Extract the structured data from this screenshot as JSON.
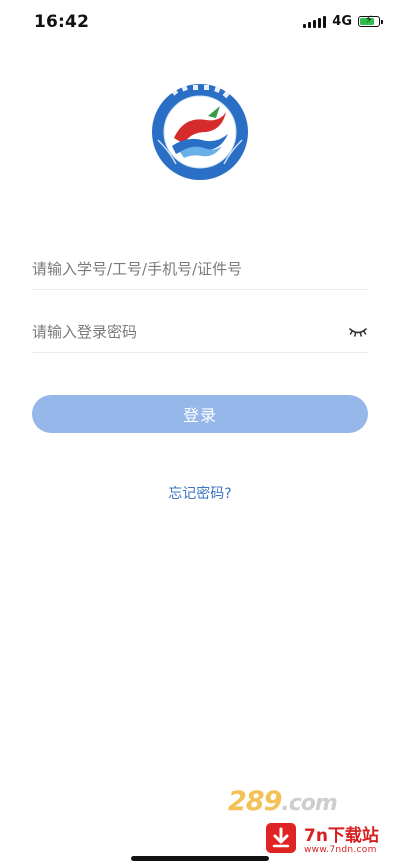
{
  "status_bar": {
    "time": "16:42",
    "network": "4G",
    "battery_level": 0.8,
    "charging": true
  },
  "logo": {
    "name": "school-logo"
  },
  "login_form": {
    "account_placeholder": "请输入学号/工号/手机号/证件号",
    "account_value": "",
    "password_placeholder": "请输入登录密码",
    "password_value": "",
    "login_label": "登录",
    "forgot_label": "忘记密码?"
  },
  "watermark": {
    "brand_text": "289",
    "brand_suffix": ".com",
    "site_name": "7n下载站",
    "site_url": "www.7ndn.com"
  },
  "colors": {
    "accent": "#95b7ea",
    "link": "#3c74c4",
    "battery": "#2fbf4a"
  }
}
